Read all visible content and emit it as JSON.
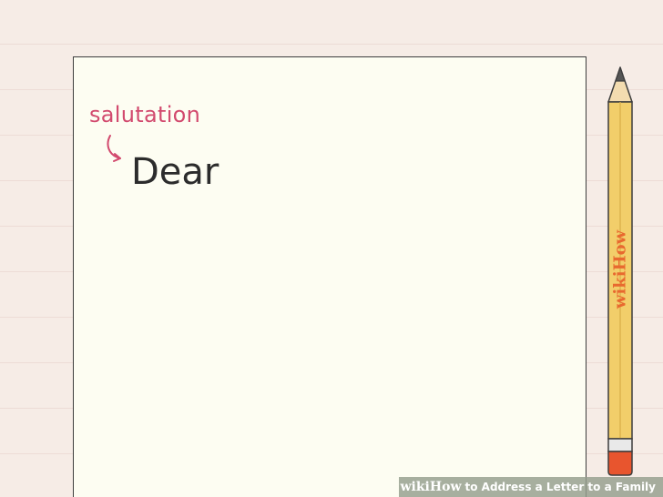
{
  "illustration": {
    "salutation_label": "salutation",
    "greeting_word": "Dear",
    "pencil_brand": "wikiHow"
  },
  "caption": {
    "brand_wiki": "wiki",
    "brand_how": "How",
    "title": "to Address a Letter to a Family"
  },
  "colors": {
    "background": "#f6ece6",
    "paper": "#fdfdf2",
    "annotation": "#d24a6e",
    "pencil_body": "#f2ce6a",
    "pencil_eraser": "#e8552e"
  }
}
